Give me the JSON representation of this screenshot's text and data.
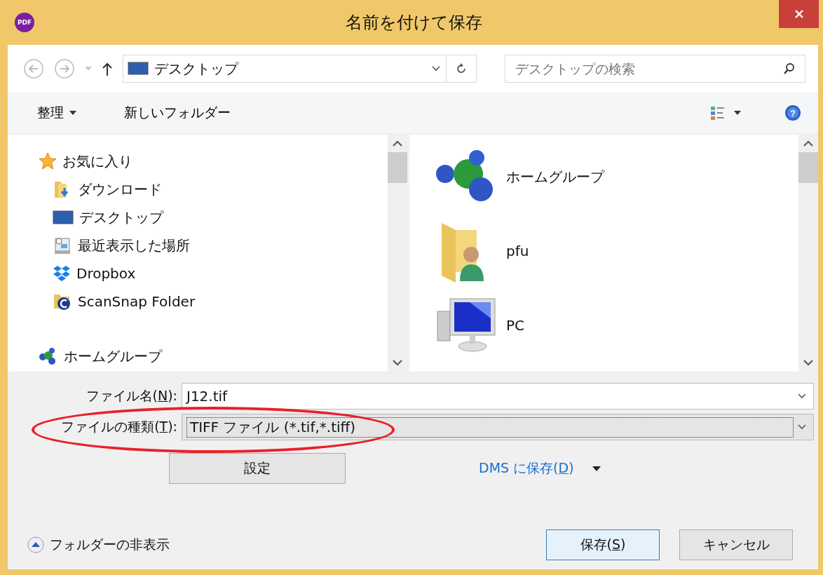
{
  "window": {
    "title": "名前を付けて保存",
    "app_badge": "PDF"
  },
  "address_bar": {
    "location": "デスクトップ"
  },
  "search": {
    "placeholder": "デスクトップの検索"
  },
  "toolbar": {
    "organize": "整理",
    "new_folder": "新しいフォルダー",
    "help_glyph": "?"
  },
  "nav_pane": {
    "groups": [
      {
        "label": "お気に入り",
        "kind": "star",
        "children": [
          {
            "label": "ダウンロード",
            "kind": "download"
          },
          {
            "label": "デスクトップ",
            "kind": "desktop"
          },
          {
            "label": "最近表示した場所",
            "kind": "recent"
          },
          {
            "label": "Dropbox",
            "kind": "dropbox"
          },
          {
            "label": "ScanSnap Folder",
            "kind": "scansnap"
          }
        ]
      },
      {
        "label": "ホームグループ",
        "kind": "homegroup"
      }
    ]
  },
  "content_items": [
    {
      "label": "ホームグループ",
      "kind": "homegroup"
    },
    {
      "label": "pfu",
      "kind": "user"
    },
    {
      "label": "PC",
      "kind": "pc"
    }
  ],
  "file_name": {
    "label_before": "ファイル名(",
    "access_key": "N",
    "label_after": "):",
    "value": "J12.tif"
  },
  "file_type": {
    "label_before": "ファイルの種類(",
    "access_key": "T",
    "label_after": "):",
    "value": "TIFF ファイル (*.tif,*.tiff)",
    "highlighted": true
  },
  "settings_button": "設定",
  "dms_link": {
    "text_before": "DMS に保存(",
    "access_key": "D",
    "text_after": ")"
  },
  "hide_folders": "フォルダーの非表示",
  "buttons": [
    {
      "text_before": "保存(",
      "access_key": "S",
      "text_after": ")",
      "kind": "default"
    },
    {
      "text_before": "キャンセル",
      "kind": "normal"
    }
  ]
}
